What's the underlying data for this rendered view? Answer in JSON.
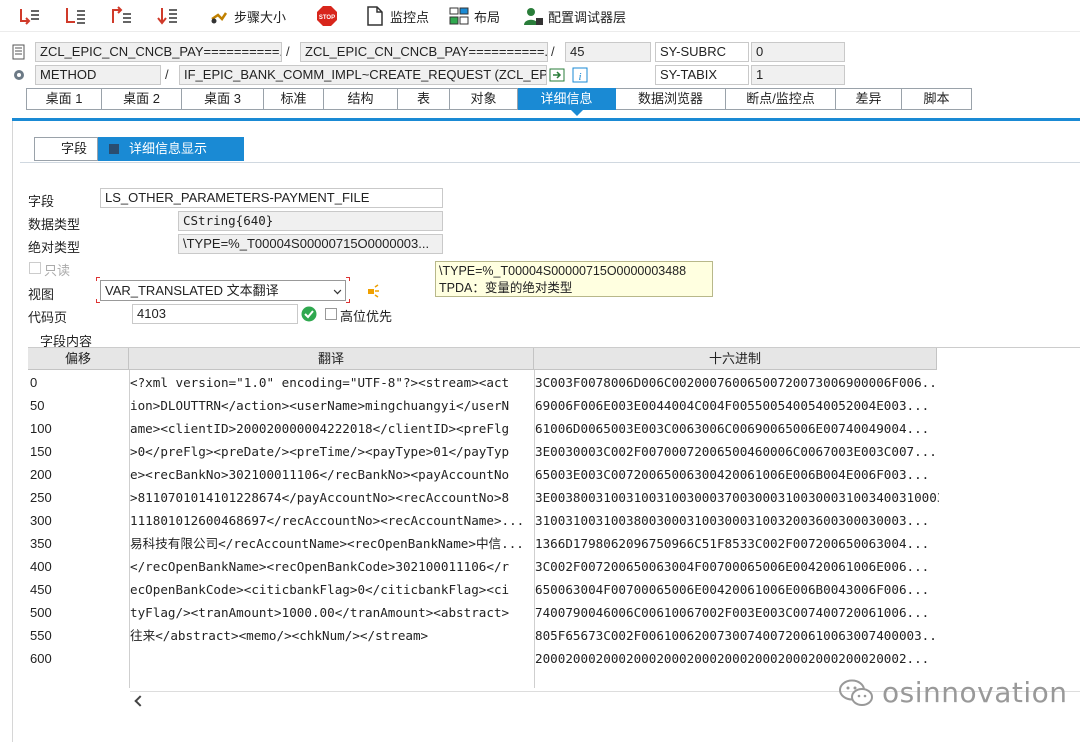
{
  "toolbar": {
    "step_into": {
      "icon": "step-single-icon"
    },
    "step_over": {
      "icon": "step-over-icon"
    },
    "step_return": {
      "icon": "return-icon"
    },
    "continue_cursor": {
      "icon": "continue-icon"
    },
    "step_size": {
      "label": "步骤大小",
      "icon": "step-size-icon"
    },
    "stop": {
      "label": "STOP",
      "icon": "stop-icon"
    },
    "watchpoint": {
      "label": "监控点",
      "icon": "document-icon"
    },
    "layout": {
      "label": "布局",
      "icon": "layout-icon"
    },
    "config": {
      "label": "配置调试器层",
      "icon": "config-user-icon"
    }
  },
  "status": {
    "program": "ZCL_EPIC_CN_CNCB_PAY==========...",
    "include": "ZCL_EPIC_CN_CNCB_PAY==========...",
    "line": "45",
    "event_type": "METHOD",
    "event": "IF_EPIC_BANK_COMM_IMPL~CREATE_REQUEST (ZCL_EPIC...",
    "sysvar1_name": "SY-SUBRC",
    "sysvar1_value": "0",
    "sysvar2_name": "SY-TABIX",
    "sysvar2_value": "1",
    "separator": "/"
  },
  "tabs": [
    "桌面 1",
    "桌面 2",
    "桌面 3",
    "标准",
    "结构",
    "表",
    "对象",
    "详细信息",
    "数据浏览器",
    "断点/监控点",
    "差异",
    "脚本"
  ],
  "active_tab": "详细信息",
  "subtabs": {
    "field": "字段",
    "detail": "详细信息显示"
  },
  "detail": {
    "field_label": "字段",
    "field_value": "LS_OTHER_PARAMETERS-PAYMENT_FILE",
    "datatype_label": "数据类型",
    "datatype_value": "CString{640}",
    "abstype_label": "绝对类型",
    "abstype_value": "\\TYPE=%_T00004S00000715O0000003...",
    "readonly_label": "只读",
    "view_label": "视图",
    "view_value": "VAR_TRANSLATED  文本翻译",
    "codepage_label": "代码页",
    "codepage_value": "4103",
    "highbit_label": "高位优先"
  },
  "tooltip": {
    "line1": "\\TYPE=%_T00004S00000715O0000003488",
    "line2": "TPDA：变量的绝对类型"
  },
  "grid": {
    "title": "字段内容",
    "headers": {
      "offset": "偏移",
      "translation": "翻译",
      "hex": "十六进制"
    },
    "rows": [
      {
        "offset": "0",
        "text": "<?xml version=\"1.0\" encoding=\"UTF-8\"?><stream><act",
        "hex": "3C003F0078006D006C00200076006500720073006900006F006..."
      },
      {
        "offset": "50",
        "text": "ion>DLOUTTRN</action><userName>mingchuangyi</userN",
        "hex": "69006F006E003E0044004C004F0055005400540052004E003..."
      },
      {
        "offset": "100",
        "text": "ame><clientID>200020000004222018</clientID><preFlg",
        "hex": "61006D0065003E003C0063006C00690065006E00740049004..."
      },
      {
        "offset": "150",
        "text": ">0</preFlg><preDate/><preTime/><payType>01</payTyp",
        "hex": "3E0030003C002F00700072006500460006C0067003E003C007..."
      },
      {
        "offset": "200",
        "text": "e><recBankNo>302100011106</recBankNo><payAccountNo",
        "hex": "65003E003C00720065006300420061006E006B004E006F003..."
      },
      {
        "offset": "250",
        "text": ">8110701014101228674</payAccountNo><recAccountNo>8",
        "hex": "3E00380031003100310030003700300031003000310034003100031003..."
      },
      {
        "offset": "300",
        "text": "111801012600468697</recAccountNo><recAccountName>...",
        "hex": "3100310031003800300031003000310032003600300030003..."
      },
      {
        "offset": "350",
        "text": "易科技有限公司</recAccountName><recOpenBankName>中信...",
        "hex": "1366D1798062096750966C51F8533C002F007200650063004..."
      },
      {
        "offset": "400",
        "text": "</recOpenBankName><recOpenBankCode>302100011106</r",
        "hex": "3C002F007200650063004F00700065006E00420061006E006..."
      },
      {
        "offset": "450",
        "text": "ecOpenBankCode><citicbankFlag>0</citicbankFlag><ci",
        "hex": "650063004F00700065006E00420061006E006B0043006F006..."
      },
      {
        "offset": "500",
        "text": "tyFlag/><tranAmount>1000.00</tranAmount><abstract>",
        "hex": "7400790046006C00610067002F003E003C007400720061006..."
      },
      {
        "offset": "550",
        "text": "往来</abstract><memo/><chkNum/></stream>",
        "hex": "805F65673C002F0061006200730074007200610063007400003..."
      },
      {
        "offset": "600",
        "text": "",
        "hex": "2000200020002000200020002000200020002000200020002..."
      }
    ]
  },
  "watermark": {
    "text": "osinnovation",
    "icon": "wechat-icon"
  }
}
